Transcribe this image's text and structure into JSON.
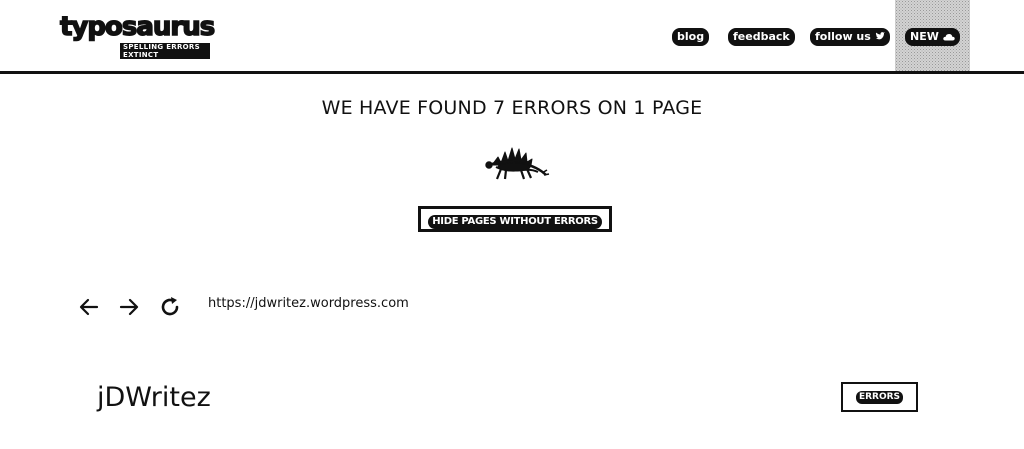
{
  "header": {
    "logo": {
      "name": "typosaurus",
      "tagline": "SPELLING ERRORS EXTINCT"
    },
    "nav": {
      "blog": "blog",
      "feedback": "feedback",
      "follow": "follow us",
      "follow_icon": "twitter-bird-icon",
      "new": "NEW",
      "new_icon": "cloud-icon"
    }
  },
  "summary": {
    "heading": "WE HAVE FOUND 7 ERRORS ON 1 PAGE",
    "hide_button": "HIDE PAGES WITHOUT ERRORS"
  },
  "browser": {
    "back_icon": "arrow-left-icon",
    "forward_icon": "arrow-right-icon",
    "reload_icon": "reload-icon",
    "url": "https://jdwritez.wordpress.com"
  },
  "result": {
    "site_title": "jDWritez",
    "errors_button": "ERRORS"
  },
  "colors": {
    "primary": "#111111",
    "background": "#ffffff"
  }
}
